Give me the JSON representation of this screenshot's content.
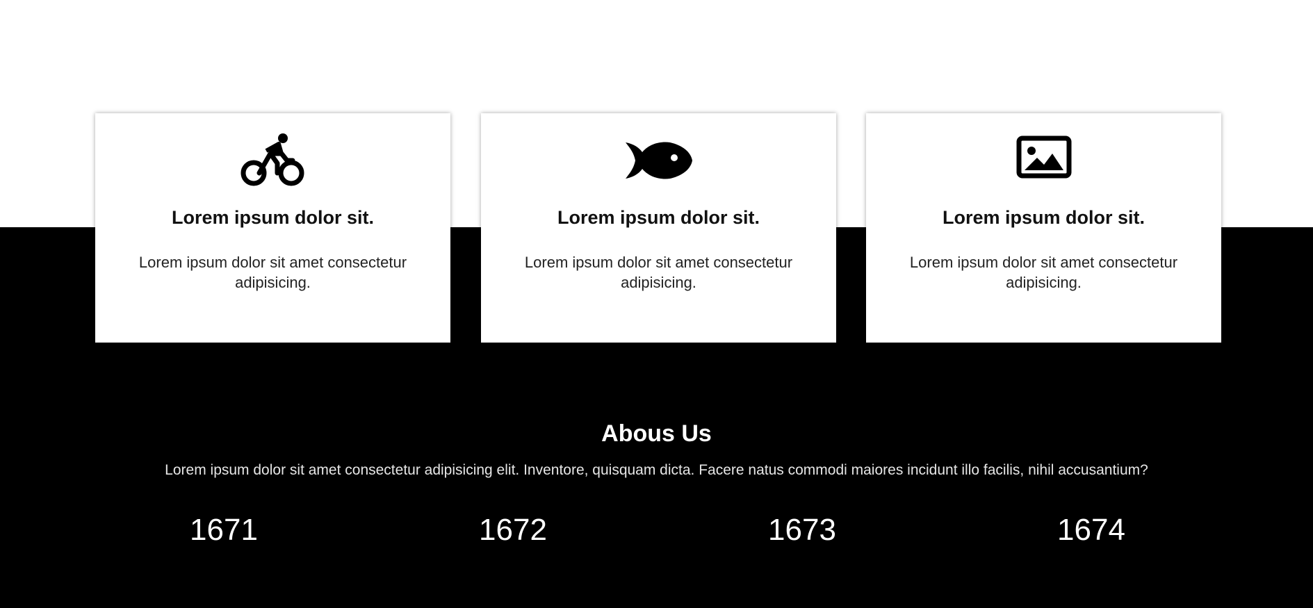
{
  "cards": [
    {
      "icon": "bicycle-icon",
      "title": "Lorem ipsum dolor sit.",
      "text": "Lorem ipsum dolor sit amet consectetur adipisicing."
    },
    {
      "icon": "fish-icon",
      "title": "Lorem ipsum dolor sit.",
      "text": "Lorem ipsum dolor sit amet consectetur adipisicing."
    },
    {
      "icon": "image-icon",
      "title": "Lorem ipsum dolor sit.",
      "text": "Lorem ipsum dolor sit amet consectetur adipisicing."
    }
  ],
  "about": {
    "title": "Abous Us",
    "text": "Lorem ipsum dolor sit amet consectetur adipisicing elit. Inventore, quisquam dicta. Facere natus commodi maiores incidunt illo facilis, nihil accusantium?"
  },
  "stats": [
    "1671",
    "1672",
    "1673",
    "1674"
  ],
  "colors": {
    "top_background": "#ffffff",
    "bottom_background": "#000000",
    "card_background": "#ffffff",
    "text_dark": "#111111",
    "text_light": "#ffffff"
  }
}
